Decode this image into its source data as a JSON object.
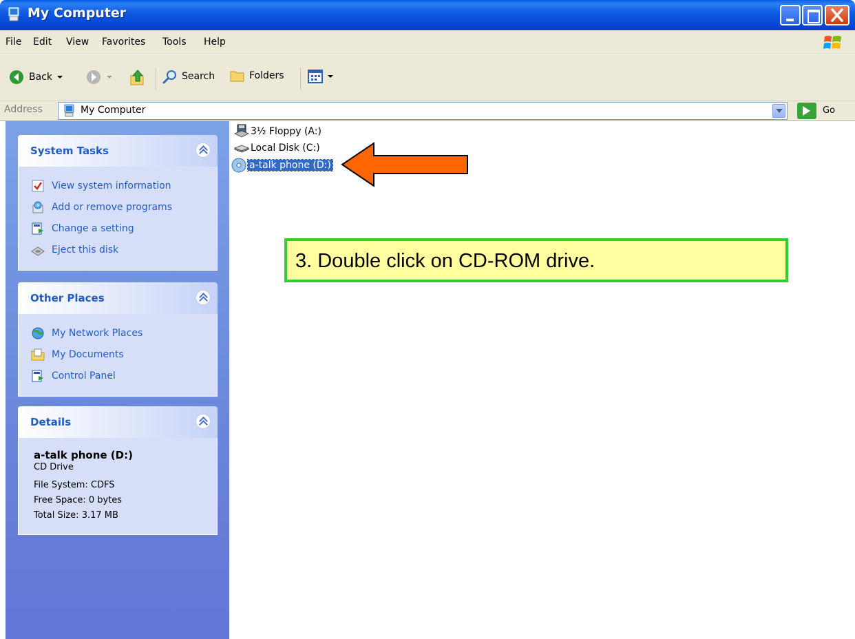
{
  "window": {
    "title": "My Computer",
    "icon": "my-computer-icon"
  },
  "menu": [
    "File",
    "Edit",
    "View",
    "Favorites",
    "Tools",
    "Help"
  ],
  "toolbar": {
    "back_label": "Back",
    "search_label": "Search",
    "folders_label": "Folders"
  },
  "address": {
    "label": "Address",
    "value": "My Computer",
    "go_label": "Go"
  },
  "system_tasks": {
    "title": "System Tasks",
    "items": [
      {
        "label": "View system information",
        "icon": "system-info-icon"
      },
      {
        "label": "Add or remove programs",
        "icon": "add-remove-programs-icon"
      },
      {
        "label": "Change a setting",
        "icon": "control-panel-icon"
      },
      {
        "label": "Eject this disk",
        "icon": "eject-disk-icon"
      }
    ]
  },
  "other_places": {
    "title": "Other Places",
    "items": [
      {
        "label": "My Network Places",
        "icon": "network-places-icon"
      },
      {
        "label": "My Documents",
        "icon": "my-documents-icon"
      },
      {
        "label": "Control Panel",
        "icon": "control-panel-icon"
      }
    ]
  },
  "details": {
    "title": "Details",
    "name": "a-talk phone (D:)",
    "type": "CD Drive",
    "file_system": "File System: CDFS",
    "free_space": "Free Space: 0 bytes",
    "total_size": "Total Size: 3.17 MB"
  },
  "drives": [
    {
      "label": "3½ Floppy (A:)",
      "icon": "floppy-drive-icon",
      "selected": false
    },
    {
      "label": "Local Disk (C:)",
      "icon": "hard-disk-icon",
      "selected": false
    },
    {
      "label": "a-talk phone (D:)",
      "icon": "cd-drive-icon",
      "selected": true
    }
  ],
  "callout": {
    "text": "3. Double click on CD-ROM drive."
  },
  "colors": {
    "accent_arrow": "#ff6600",
    "callout_border": "#33cc33",
    "callout_fill": "#ffffa0",
    "selection": "#316ac5"
  }
}
